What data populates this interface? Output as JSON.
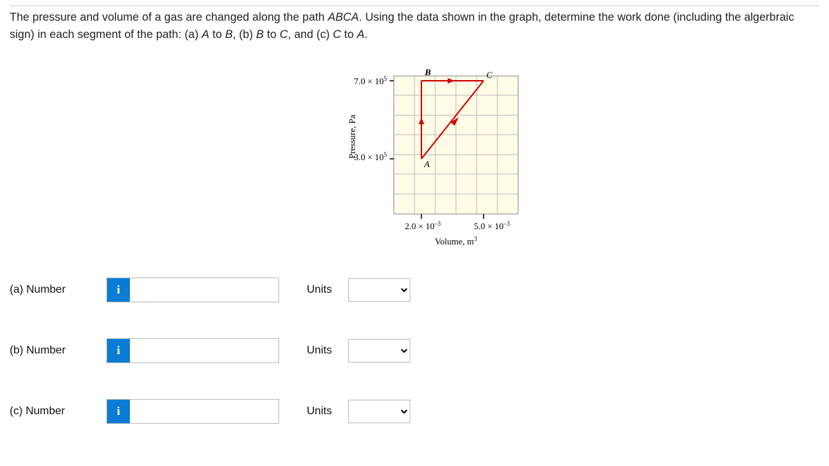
{
  "question": {
    "text_before_path": "The pressure and volume of a gas are changed along the path ",
    "path": "ABCA",
    "text_after_path": ". Using the data shown in the graph, determine the work done (including the algerbraic sign) in each segment of the path: (a) ",
    "seg_a": "A",
    "to1": " to ",
    "seg_b": "B",
    "mid2": ", (b) ",
    "seg_b2": "B",
    "to2": " to ",
    "seg_c": "C",
    "mid3": ", and (c) ",
    "seg_c2": "C",
    "to3": " to ",
    "seg_a2": "A",
    "end": "."
  },
  "chart_data": {
    "type": "line",
    "xlabel": "Volume, m³",
    "ylabel": "Pressure, Pa",
    "x_ticks": [
      "2.0 × 10⁻³",
      "5.0 × 10⁻³"
    ],
    "y_ticks": [
      "3.0 × 10⁵",
      "7.0 × 10⁵"
    ],
    "xlim": [
      0.001,
      0.006
    ],
    "ylim": [
      100000,
      800000
    ],
    "points": {
      "A": {
        "volume": 0.002,
        "pressure": 300000
      },
      "B": {
        "volume": 0.002,
        "pressure": 700000
      },
      "C": {
        "volume": 0.005,
        "pressure": 700000
      }
    },
    "path": [
      "A",
      "B",
      "C",
      "A"
    ],
    "labels": {
      "A": "A",
      "B": "B",
      "C": "C"
    }
  },
  "answers": {
    "a": {
      "label": "(a)   Number",
      "units_label": "Units",
      "value": "",
      "units_value": ""
    },
    "b": {
      "label": "(b)   Number",
      "units_label": "Units",
      "value": "",
      "units_value": ""
    },
    "c": {
      "label": "(c)   Number",
      "units_label": "Units",
      "value": "",
      "units_value": ""
    }
  },
  "icons": {
    "info": "i"
  }
}
